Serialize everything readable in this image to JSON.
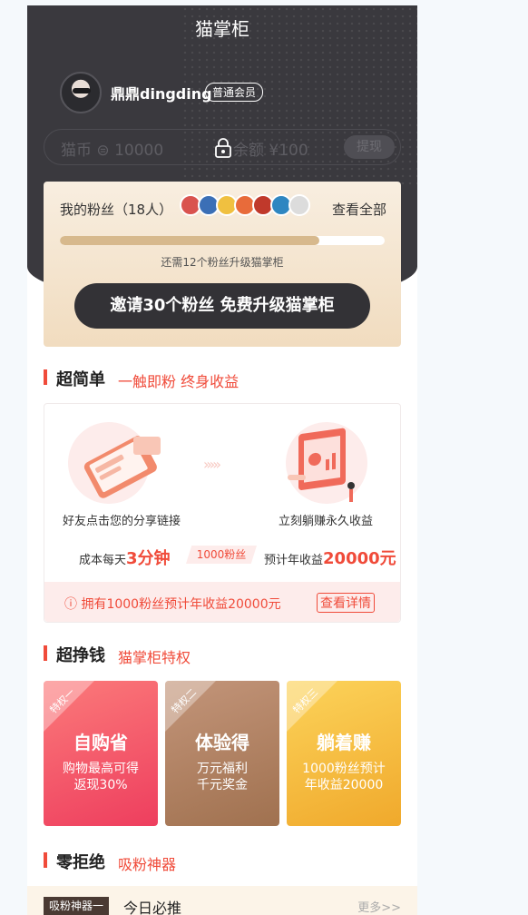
{
  "header": {
    "title": "猫掌柜"
  },
  "user": {
    "name": "鼎鼎dingding",
    "level": "普通会员"
  },
  "wallet": {
    "coins_label": "猫币",
    "coins_value": "10000",
    "balance_label": "余额 ¥100",
    "withdraw_label": "提现"
  },
  "fans": {
    "label": "我的粉丝（18人）",
    "see_all": "查看全部",
    "progress_fraction": 0.8,
    "progress_hint": "还需12个粉丝升级猫掌柜",
    "invite_button": "邀请30个粉丝  免费升级猫掌柜",
    "avatar_colors": [
      "#d9534f",
      "#3b6fb6",
      "#f0c040",
      "#e86b3a",
      "#c0392b",
      "#2e86c1",
      "#dcdcdc"
    ]
  },
  "section1": {
    "title": "超简单",
    "subtitle": "一触即粉  终身收益",
    "step1_text": "好友点击您的分享链接",
    "step2_text": "立刻躺赚永久收益",
    "cost_prefix": "成本每天",
    "cost_value": "3分钟",
    "tag_text": "1000粉丝",
    "income_prefix": "预计年收益",
    "income_value": "20000元",
    "info_text": "ⓘ 拥有1000粉丝预计年收益20000元",
    "info_link": "查看详情"
  },
  "section2": {
    "title": "超挣钱",
    "subtitle": "猫掌柜特权",
    "cards": [
      {
        "tag": "特权一",
        "title": "自购省",
        "desc_line1": "购物最高可得",
        "desc_line2": "返现30%"
      },
      {
        "tag": "特权二",
        "title": "体验得",
        "desc_line1": "万元福利",
        "desc_line2": "千元奖金"
      },
      {
        "tag": "特权三",
        "title": "躺着赚",
        "desc_line1": "1000粉丝预计",
        "desc_line2": "年收益20000"
      }
    ]
  },
  "section3": {
    "title": "零拒绝",
    "subtitle": "吸粉神器"
  },
  "today": {
    "tag": "吸粉神器一",
    "title": "今日必推",
    "more": "更多>>"
  }
}
